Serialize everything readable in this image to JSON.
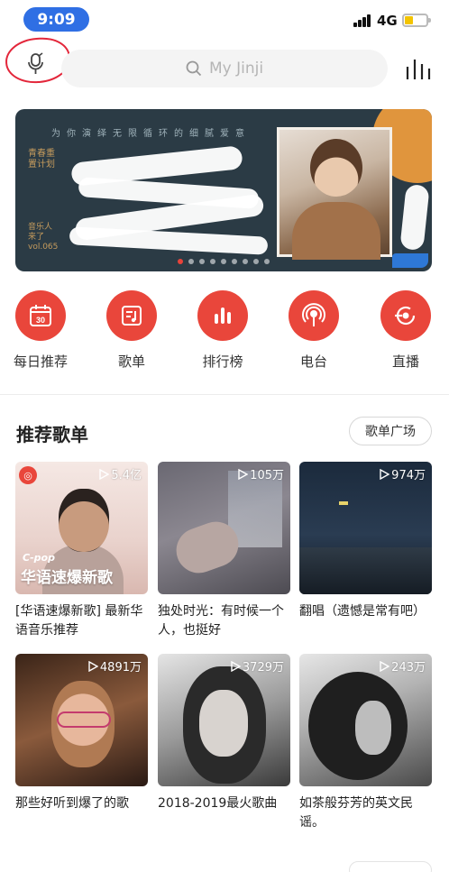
{
  "status_bar": {
    "time": "9:09",
    "network": "4G"
  },
  "search": {
    "placeholder": "My Jinji"
  },
  "banner": {
    "top_text": "为你演绎无限循环的细腻爱意",
    "left_text_1": "青春重置计划",
    "left_text_2": "音乐人来了 vol.065"
  },
  "quick_nav": [
    {
      "label": "每日推荐",
      "icon": "calendar-icon",
      "day": "30"
    },
    {
      "label": "歌单",
      "icon": "playlist-icon"
    },
    {
      "label": "排行榜",
      "icon": "chart-icon"
    },
    {
      "label": "电台",
      "icon": "radio-icon"
    },
    {
      "label": "直播",
      "icon": "live-icon"
    }
  ],
  "section": {
    "title": "推荐歌单",
    "plaza_button": "歌单广场"
  },
  "cover_text": {
    "small": "C-pop",
    "big": "华语速爆新歌"
  },
  "playlists": [
    {
      "plays": "5.4亿",
      "title": "[华语速爆新歌] 最新华语音乐推荐"
    },
    {
      "plays": "105万",
      "title": "独处时光：有时候一个人，也挺好"
    },
    {
      "plays": "974万",
      "title": "翻唱（遗憾是常有吧）"
    },
    {
      "plays": "4891万",
      "title": "那些好听到爆了的歌"
    },
    {
      "plays": "3729万",
      "title": "2018-2019最火歌曲"
    },
    {
      "plays": "243万",
      "title": "如茶般芬芳的英文民谣。"
    }
  ],
  "colors": {
    "accent": "#e9463b",
    "time_pill": "#2f6fe4",
    "annotation": "#e3263a"
  }
}
